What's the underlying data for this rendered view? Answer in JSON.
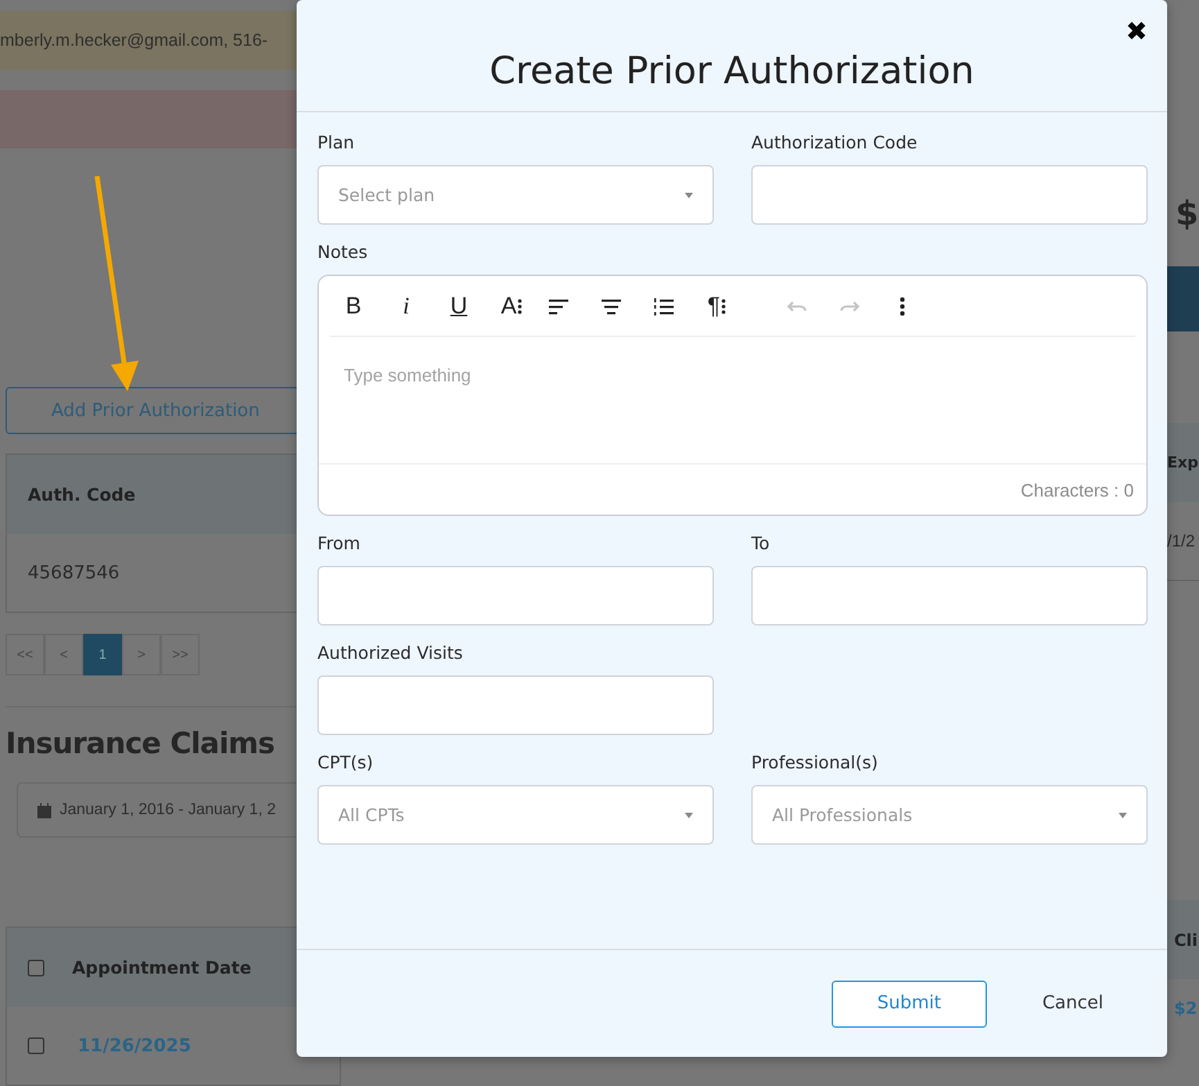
{
  "background": {
    "contact_banner": "mberly.m.hecker@gmail.com, 516-",
    "add_button": "Add Prior Authorization",
    "auth_table": {
      "columns": [
        "Auth. Code"
      ],
      "rows": [
        [
          "45687546"
        ]
      ]
    },
    "pagination": [
      {
        "label": "<<",
        "selected": false
      },
      {
        "label": "<",
        "selected": false
      },
      {
        "label": "1",
        "selected": true
      },
      {
        "label": ">",
        "selected": false
      },
      {
        "label": ">>",
        "selected": false
      }
    ],
    "claims_title": "Insurance Claims",
    "date_range": "January 1, 2016 - January 1, 2",
    "claims_table": {
      "header_checked": false,
      "columns": [
        "Appointment Date"
      ],
      "rows": [
        {
          "checked": false,
          "date": "11/26/2025"
        }
      ]
    },
    "right_edge": {
      "amount": "$",
      "header": "Exp",
      "value": "/1/2",
      "claims_header": "Cli",
      "claims_value": "$2"
    }
  },
  "modal": {
    "title": "Create Prior Authorization",
    "close": "✖",
    "rows": [
      [
        {
          "kind": "select",
          "label": "Plan",
          "placeholder": "Select plan"
        },
        {
          "kind": "text",
          "label": "Authorization Code"
        }
      ],
      [
        {
          "kind": "editor",
          "label": "Notes",
          "placeholder": "Type something",
          "counter": "Characters : 0",
          "tool_groups": [
            [
              {
                "kind": "bold",
                "label": "B"
              },
              {
                "kind": "italic",
                "label": "i"
              },
              {
                "kind": "underline",
                "label": "U"
              },
              {
                "kind": "font-size",
                "label": "A"
              }
            ],
            [
              {
                "kind": "align-left"
              },
              {
                "kind": "align-center"
              },
              {
                "kind": "ordered-list"
              },
              {
                "kind": "paragraph",
                "label": "¶"
              }
            ],
            [
              {
                "kind": "undo",
                "disabled": true
              },
              {
                "kind": "redo",
                "disabled": true
              },
              {
                "kind": "more",
                "disabled": false
              }
            ]
          ]
        }
      ],
      [
        {
          "kind": "text",
          "label": "From"
        },
        {
          "kind": "text",
          "label": "To"
        }
      ],
      [
        {
          "kind": "text",
          "label": "Authorized Visits"
        }
      ],
      [
        {
          "kind": "select",
          "label": "CPT(s)",
          "placeholder": "All CPTs"
        },
        {
          "kind": "select",
          "label": "Professional(s)",
          "placeholder": "All Professionals"
        }
      ]
    ],
    "buttons": [
      {
        "kind": "primary",
        "label": "Submit"
      },
      {
        "kind": "plain",
        "label": "Cancel"
      }
    ]
  }
}
